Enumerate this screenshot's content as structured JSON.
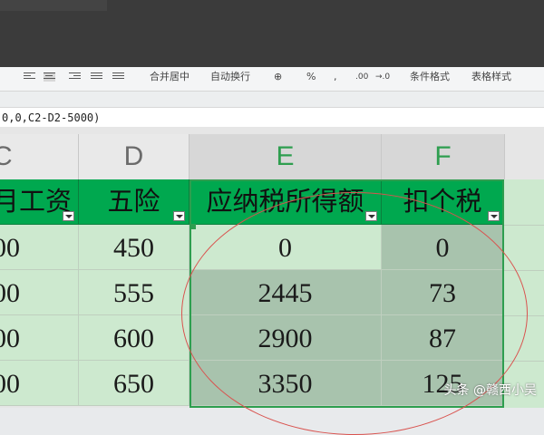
{
  "ribbon": {
    "merge_center": "合并居中",
    "auto_wrap": "自动换行",
    "percent": "%",
    "comma": ",",
    "decimal_add": ".00",
    "decimal_remove": "→.0",
    "conditional_format": "条件格式",
    "table_style": "表格样式"
  },
  "formula": {
    "text": "0,0,C2-D2-5000)"
  },
  "columns": [
    {
      "letter": "C"
    },
    {
      "letter": "D"
    },
    {
      "letter": "E"
    },
    {
      "letter": "F"
    }
  ],
  "headers": [
    "月工资",
    "五险",
    "应纳税所得额",
    "扣个税"
  ],
  "rows": [
    {
      "salary": "00",
      "insurance": "450",
      "taxable": "0",
      "tax": "0"
    },
    {
      "salary": "00",
      "insurance": "555",
      "taxable": "2445",
      "tax": "73"
    },
    {
      "salary": "00",
      "insurance": "600",
      "taxable": "2900",
      "tax": "87"
    },
    {
      "salary": "00",
      "insurance": "650",
      "taxable": "3350",
      "tax": "125"
    }
  ],
  "watermark": "头条 @赣西小吴",
  "colors": {
    "header_green": "#00a84f",
    "light_green": "#cde9cf",
    "selected_green": "#a8c3ad",
    "circle_red": "#d9534f"
  }
}
